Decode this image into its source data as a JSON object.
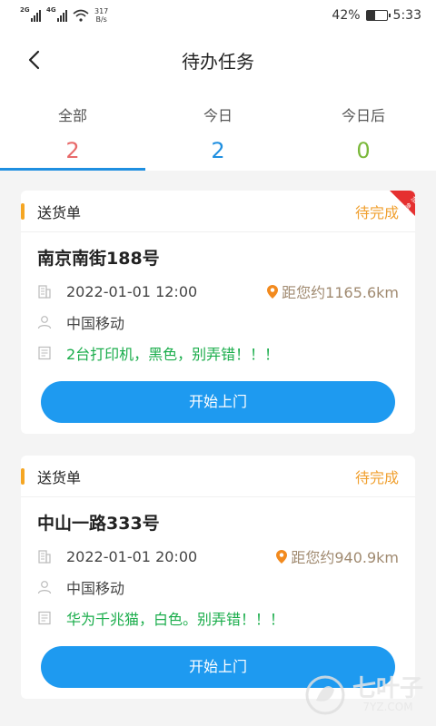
{
  "status_bar": {
    "signal1_tag": "2G",
    "signal2_tag": "4G",
    "speed_value": "317",
    "speed_unit": "B/s",
    "battery_pct": "42%",
    "battery_level": 0.42,
    "time": "5:33"
  },
  "header": {
    "title": "待办任务",
    "back_icon": "chevron-left-icon"
  },
  "tabs": [
    {
      "label": "全部",
      "count": "2",
      "color": "#e86a6a"
    },
    {
      "label": "今日",
      "count": "2",
      "color": "#1f8fe0"
    },
    {
      "label": "今日后",
      "count": "0",
      "color": "#7ab83a"
    }
  ],
  "tasks": [
    {
      "type": "送货单",
      "status": "待完成",
      "ribbon": "加急",
      "address": "南京南街188号",
      "datetime": "2022-01-01 12:00",
      "distance": "距您约1165.6km",
      "company": "中国移动",
      "note": "2台打印机，黑色，别弄错！！！",
      "button": "开始上门"
    },
    {
      "type": "送货单",
      "status": "待完成",
      "address": "中山一路333号",
      "datetime": "2022-01-01 20:00",
      "distance": "距您约940.9km",
      "company": "中国移动",
      "note": "华为千兆猫，白色。别弄错！！！",
      "button": "开始上门"
    }
  ],
  "watermark": {
    "text": "七叶子",
    "sub": "7YZ.COM"
  },
  "colors": {
    "accent": "#1e9af0",
    "status": "#f0a030",
    "note": "#1aad4b",
    "bar": "#f5a623"
  }
}
